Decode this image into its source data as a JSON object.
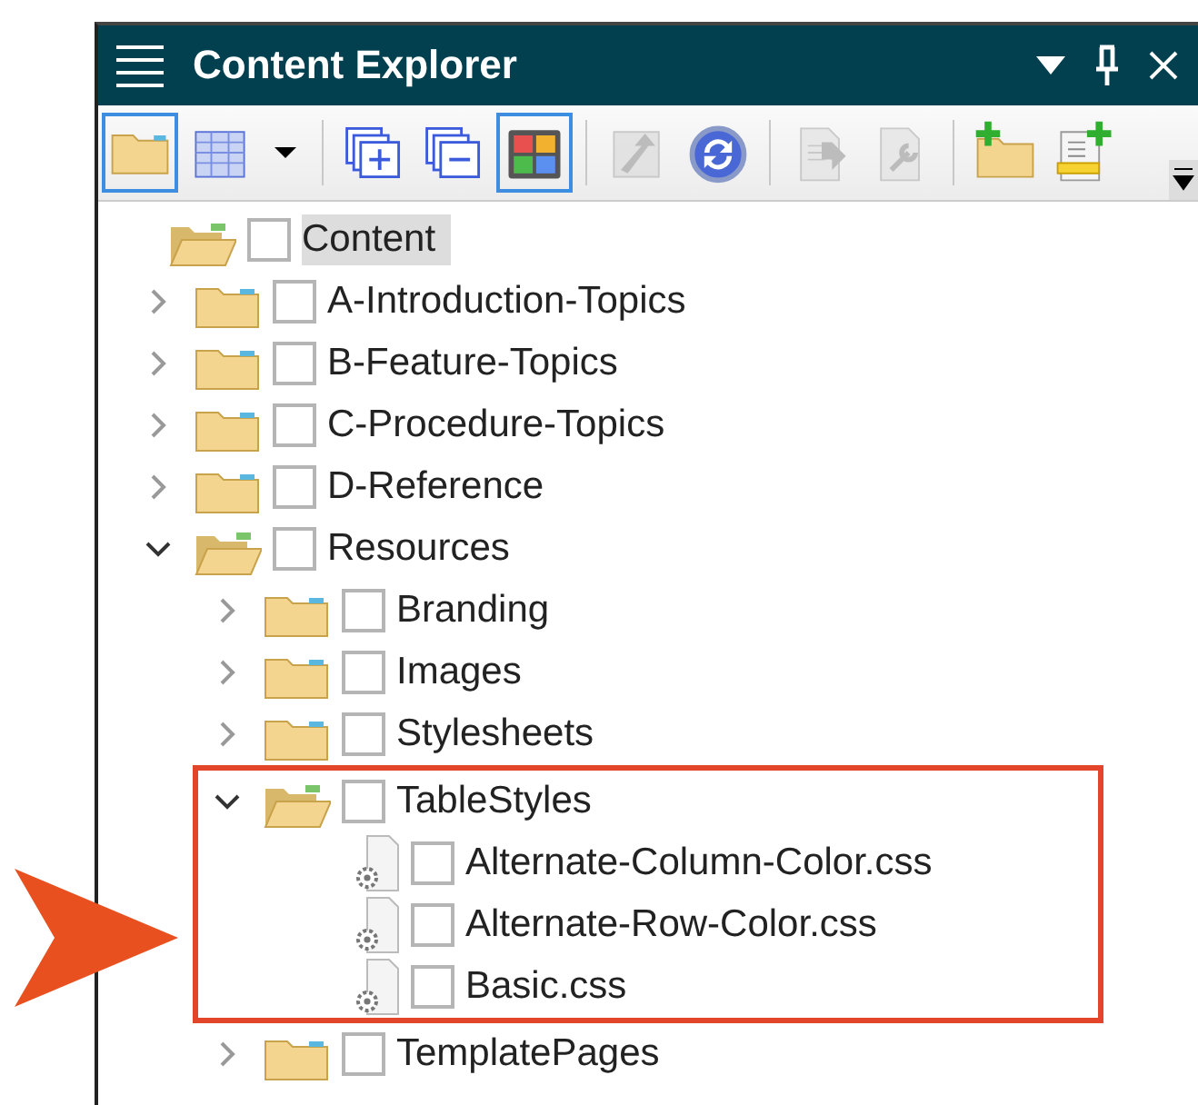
{
  "window": {
    "title": "Content Explorer"
  },
  "toolbar": [
    {
      "kind": "folder",
      "selected": true,
      "disabled": false
    },
    {
      "kind": "grid",
      "selected": false,
      "disabled": false
    },
    {
      "kind": "dropdown",
      "selected": false,
      "disabled": false
    },
    {
      "kind": "separator"
    },
    {
      "kind": "expand-all",
      "selected": false,
      "disabled": false
    },
    {
      "kind": "collapse-all",
      "selected": false,
      "disabled": false
    },
    {
      "kind": "color-tiles",
      "selected": true,
      "disabled": false
    },
    {
      "kind": "separator"
    },
    {
      "kind": "move-up",
      "selected": false,
      "disabled": true
    },
    {
      "kind": "refresh",
      "selected": false,
      "disabled": false
    },
    {
      "kind": "separator"
    },
    {
      "kind": "document-arrow",
      "selected": false,
      "disabled": true
    },
    {
      "kind": "document-wrench",
      "selected": false,
      "disabled": true
    },
    {
      "kind": "separator"
    },
    {
      "kind": "new-folder",
      "selected": false,
      "disabled": false
    },
    {
      "kind": "new-file",
      "selected": false,
      "disabled": false
    }
  ],
  "tree": [
    {
      "label": "Content",
      "kind": "folder",
      "selected": true,
      "checked": false,
      "children": [
        {
          "label": "A-Introduction-Topics",
          "kind": "folder",
          "selected": false,
          "checked": false,
          "expanded": false
        },
        {
          "label": "B-Feature-Topics",
          "kind": "folder",
          "selected": false,
          "checked": false,
          "expanded": false
        },
        {
          "label": "C-Procedure-Topics",
          "kind": "folder",
          "selected": false,
          "checked": false,
          "expanded": false
        },
        {
          "label": "D-Reference",
          "kind": "folder",
          "selected": false,
          "checked": false,
          "expanded": false
        },
        {
          "label": "Resources",
          "kind": "folder",
          "selected": false,
          "checked": false,
          "expanded": true,
          "children": [
            {
              "label": "Branding",
              "kind": "folder",
              "selected": false,
              "checked": false,
              "expanded": false
            },
            {
              "label": "Images",
              "kind": "folder",
              "selected": false,
              "checked": false,
              "expanded": false
            },
            {
              "label": "Stylesheets",
              "kind": "folder",
              "selected": false,
              "checked": false,
              "expanded": false
            },
            {
              "label": "TableStyles",
              "kind": "folder",
              "selected": false,
              "checked": false,
              "expanded": true,
              "highlighted": true,
              "children": [
                {
                  "label": "Alternate-Column-Color.css",
                  "kind": "stylesheet",
                  "selected": false,
                  "checked": false
                },
                {
                  "label": "Alternate-Row-Color.css",
                  "kind": "stylesheet",
                  "selected": false,
                  "checked": false
                },
                {
                  "label": "Basic.css",
                  "kind": "stylesheet",
                  "selected": false,
                  "checked": false
                }
              ]
            },
            {
              "label": "TemplatePages",
              "kind": "folder",
              "selected": false,
              "checked": false,
              "expanded": false
            }
          ]
        }
      ]
    }
  ]
}
